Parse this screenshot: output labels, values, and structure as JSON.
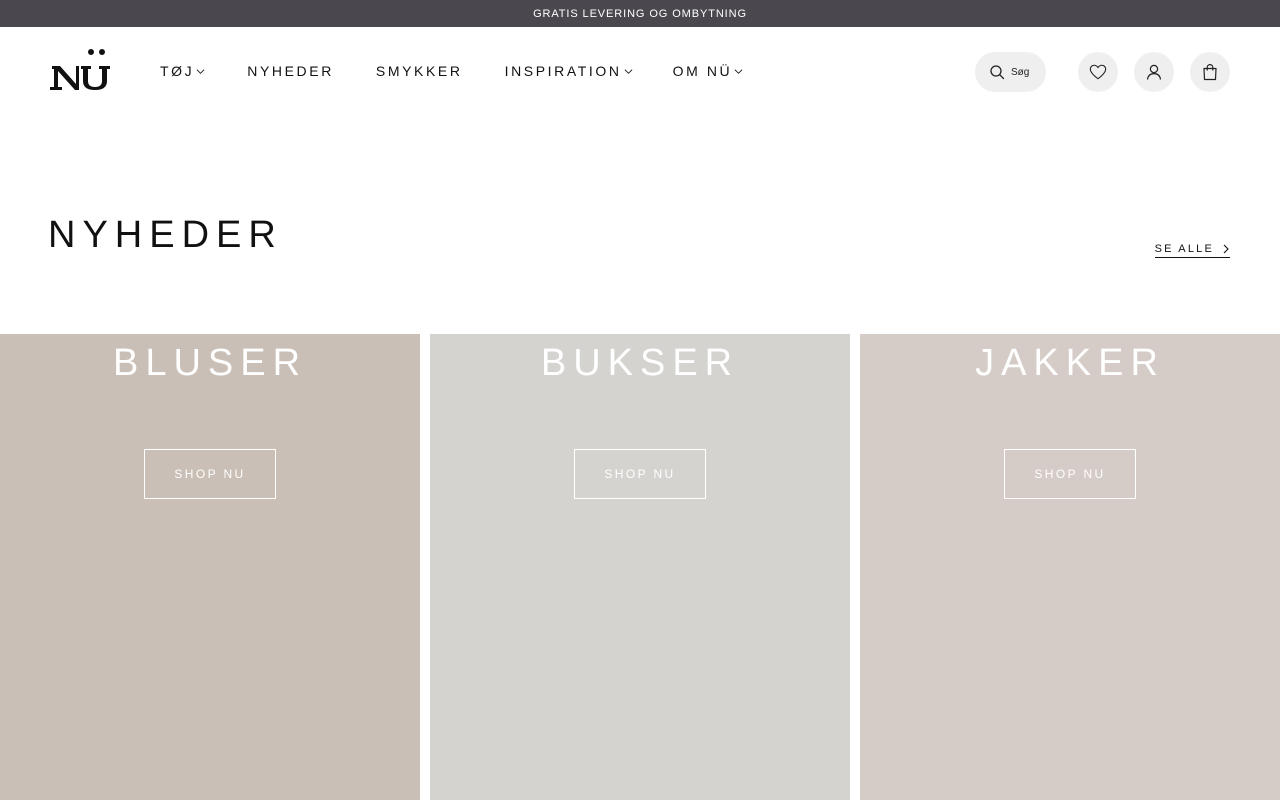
{
  "announcement": "GRATIS LEVERING OG OMBYTNING",
  "logo": {
    "text": "NÜ"
  },
  "nav": {
    "items": [
      {
        "label": "TØJ",
        "has_dropdown": true
      },
      {
        "label": "NYHEDER",
        "has_dropdown": false
      },
      {
        "label": "SMYKKER",
        "has_dropdown": false
      },
      {
        "label": "INSPIRATION",
        "has_dropdown": true
      },
      {
        "label": "OM NÜ",
        "has_dropdown": true
      }
    ]
  },
  "header_actions": {
    "search_label": "Søg",
    "icons": [
      "search-icon",
      "heart-icon",
      "user-icon",
      "bag-icon"
    ]
  },
  "section": {
    "title": "NYHEDER",
    "see_all": "SE ALLE"
  },
  "categories": [
    {
      "title": "BLUSER",
      "button": "SHOP NU",
      "color": "#c9bfb6"
    },
    {
      "title": "BUKSER",
      "button": "SHOP NU",
      "color": "#d4d3cf"
    },
    {
      "title": "JAKKER",
      "button": "SHOP NU",
      "color": "#d5ccc7"
    }
  ],
  "colors": {
    "announcement_bg": "#4a484e",
    "icon_bg": "#efefef",
    "text": "#111111"
  }
}
